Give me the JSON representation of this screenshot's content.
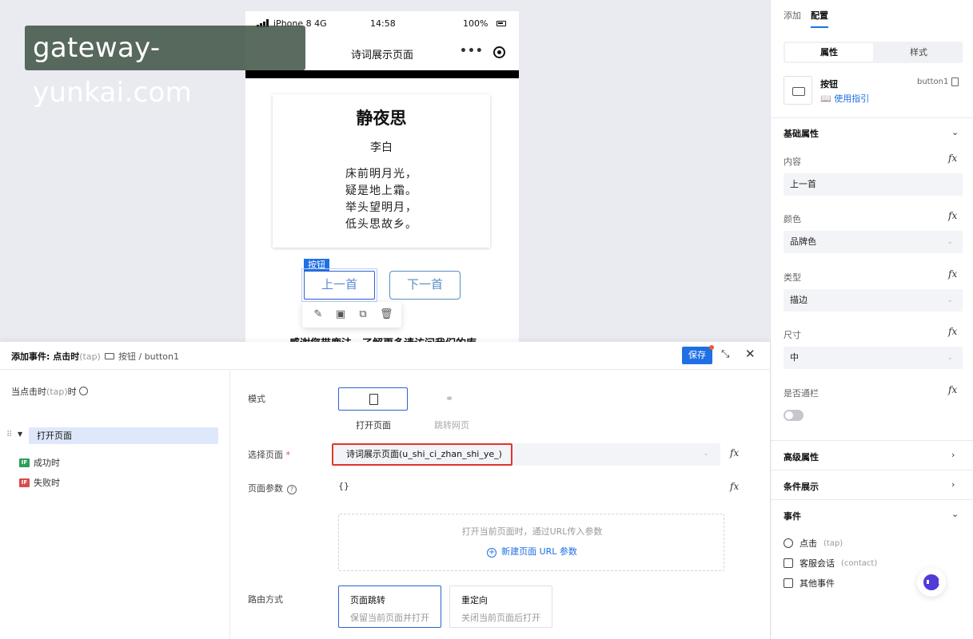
{
  "watermark": "gateway-yunkai.com",
  "phone": {
    "status": {
      "carrier": "iPhone 8  4G",
      "time": "14:58",
      "battery": "100%"
    },
    "nav_title": "诗词展示页面",
    "nav_more": "•••",
    "poem": {
      "title": "静夜思",
      "author": "李白",
      "lines": [
        "床前明月光，",
        "疑是地上霜。",
        "举头望明月，",
        "低头思故乡。"
      ]
    },
    "selected_tag": "按钮",
    "prev_button": "上一首",
    "next_button": "下一首",
    "footer_text": "感谢您带鹿法，了解更多请访问我们的库"
  },
  "right_panel": {
    "tabs": [
      "添加",
      "配置"
    ],
    "segment": [
      "属性",
      "样式"
    ],
    "component": {
      "name": "按钮",
      "guide": "使用指引",
      "id": "button1"
    },
    "sections": {
      "basic": "基础属性",
      "advanced": "高级属性",
      "conditional": "条件展示",
      "events": "事件"
    },
    "fields": [
      {
        "label": "内容",
        "value": "上一首"
      },
      {
        "label": "颜色",
        "value": "品牌色"
      },
      {
        "label": "类型",
        "value": "描边"
      },
      {
        "label": "尺寸",
        "value": "中"
      }
    ],
    "fullwidth_label": "是否通栏",
    "fullwidth_on": false,
    "fx": "fx",
    "events": [
      {
        "label": "点击",
        "sub": "(tap)",
        "icon": "tap-icon"
      },
      {
        "label": "客服会话",
        "sub": "(contact)",
        "icon": "chat-icon"
      },
      {
        "label": "其他事件",
        "sub": "",
        "icon": "calendar-icon"
      }
    ]
  },
  "dialog": {
    "title": "添加事件: 点击时",
    "title_sub": "(tap)",
    "crumb": "按钮 / button1",
    "save": "保存",
    "expand": "⤡",
    "close": "✕",
    "trigger": "当点击时",
    "trigger_sub": "(tap)",
    "trigger_suffix": "时",
    "action": "打开页面",
    "success": "成功时",
    "fail": "失败时",
    "if_badge": "IF",
    "mode_label": "模式",
    "mode_open": "打开页面",
    "mode_jump": "跳转网页",
    "select_page_label": "选择页面",
    "select_page_req": "*",
    "select_page_value": "诗词展示页面(u_shi_ci_zhan_shi_ye_)",
    "params_label": "页面参数",
    "params_value": "{}",
    "params_hint": "打开当前页面时，通过URL传入参数",
    "params_add": "新建页面 URL 参数",
    "route_label": "路由方式",
    "routes": [
      {
        "title": "页面跳转",
        "desc": "保留当前页面并打开"
      },
      {
        "title": "重定向",
        "desc": "关闭当前页面后打开"
      }
    ]
  },
  "colors": {
    "accent": "#1f6fe5",
    "highlight": "#e0352b",
    "if_success": "#2e9e5b",
    "if_fail": "#d94b4b"
  }
}
